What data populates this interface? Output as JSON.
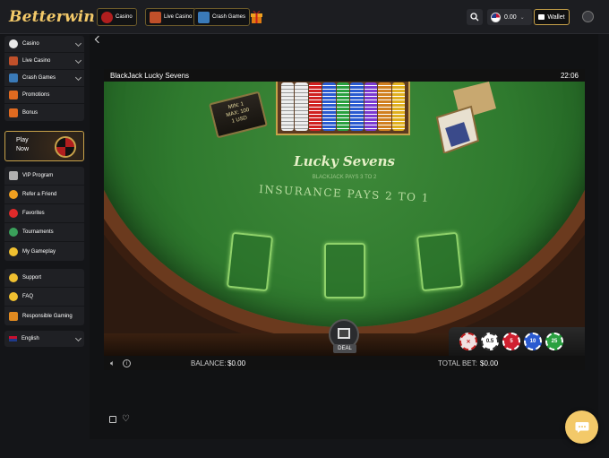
{
  "brand": {
    "logo": "Betterwin"
  },
  "topnav": [
    {
      "label": "Casino",
      "icon": "casino-chip-icon"
    },
    {
      "label": "Live Casino",
      "icon": "live-dealer-icon"
    },
    {
      "label": "Crash Games",
      "icon": "plane-icon"
    }
  ],
  "header": {
    "balance": "0.00",
    "wallet_label": "Wallet"
  },
  "sidebar": {
    "categories": [
      {
        "label": "Casino",
        "icon": "casino-icon"
      },
      {
        "label": "Live Casino",
        "icon": "live-casino-icon"
      },
      {
        "label": "Crash Games",
        "icon": "crash-games-icon"
      },
      {
        "label": "Promotions",
        "icon": "promotions-icon"
      },
      {
        "label": "Bonus",
        "icon": "bonus-icon"
      }
    ],
    "play_now": {
      "line1": "Play",
      "line2": "Now"
    },
    "engage": [
      {
        "label": "VIP Program",
        "icon": "crown-icon"
      },
      {
        "label": "Refer a Friend",
        "icon": "refer-icon"
      },
      {
        "label": "Favorites",
        "icon": "heart-icon"
      },
      {
        "label": "Tournaments",
        "icon": "tournament-icon"
      },
      {
        "label": "My Gameplay",
        "icon": "gameplay-icon"
      }
    ],
    "help": [
      {
        "label": "Support",
        "icon": "support-icon"
      },
      {
        "label": "FAQ",
        "icon": "faq-icon"
      },
      {
        "label": "Responsible Gaming",
        "icon": "responsible-icon"
      }
    ],
    "language": "English"
  },
  "game": {
    "title": "BlackJack Lucky Sevens",
    "clock": "22:06",
    "table_logo": "Lucky Sevens",
    "rule_line": "BLACKJACK PAYS 3 TO 2",
    "insurance": "INSURANCE PAYS 2 TO 1",
    "limits": {
      "min": "MIN: 1",
      "max": "MAX: 100",
      "unit": "1 USD"
    },
    "deal_label": "DEAL",
    "chips": [
      "0.5",
      "5",
      "10",
      "25"
    ],
    "balance_label": "BALANCE:",
    "balance_value": "$0.00",
    "total_bet_label": "TOTAL BET:",
    "total_bet_value": "$0.00"
  },
  "colors": {
    "accent": "#f3c969",
    "felt": "#2f7a2e",
    "panel": "#1f2024"
  }
}
